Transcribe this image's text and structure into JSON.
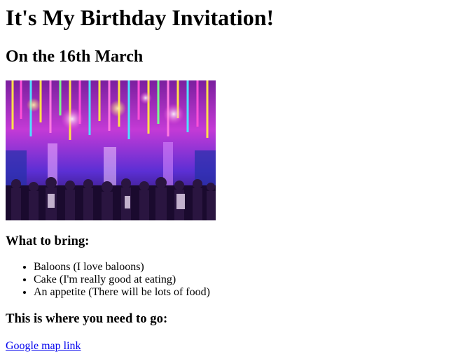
{
  "title": "It's My Birthday Invitation!",
  "subtitle": "On the 16th March",
  "photo": {
    "alt": "",
    "colors": {
      "ceiling": "#c43ad6",
      "pink": "#ff4fd8",
      "purple": "#5b2fd4",
      "blue": "#2430a8",
      "yellow": "#ffe04a",
      "dark": "#1a0a2e"
    }
  },
  "bring": {
    "heading": "What to bring:",
    "items": [
      "Baloons (I love baloons)",
      "Cake (I'm really good at eating)",
      "An appetite (There will be lots of food)"
    ]
  },
  "directions": {
    "heading": "This is where you need to go:",
    "link_text": "Google map link"
  }
}
